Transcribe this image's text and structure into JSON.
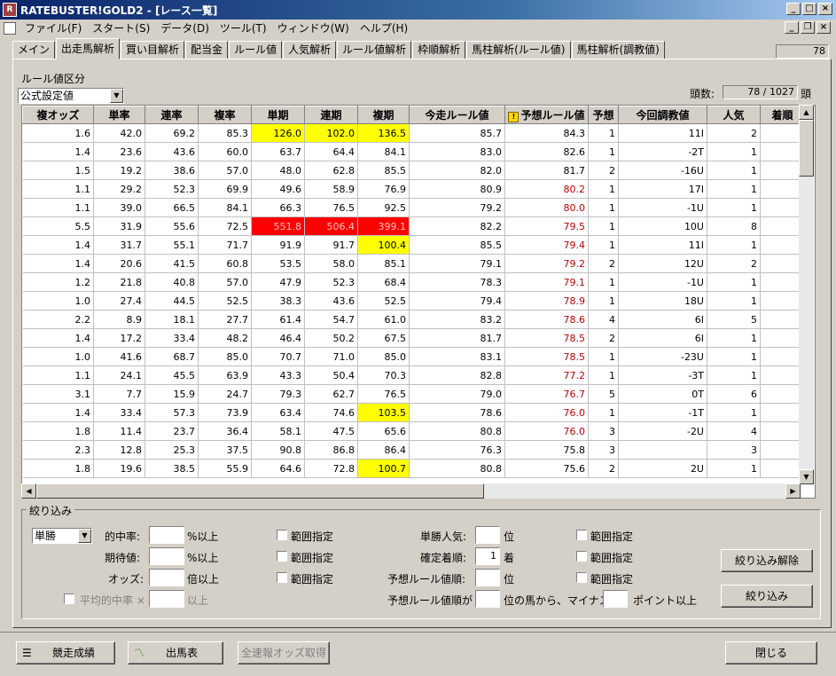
{
  "window": {
    "title": "RATEBUSTER!GOLD2 - [レース一覧]",
    "app_icon": "app-icon"
  },
  "menu": [
    "ファイル(F)",
    "スタート(S)",
    "データ(D)",
    "ツール(T)",
    "ウィンドウ(W)",
    "ヘルプ(H)"
  ],
  "tabs": [
    "メイン",
    "出走馬解析",
    "買い目解析",
    "配当金",
    "ルール値",
    "人気解析",
    "ルール値解析",
    "枠順解析",
    "馬柱解析(ルール値)",
    "馬柱解析(調教値)"
  ],
  "active_tab": "出走馬解析",
  "top_count": "78",
  "rule_section": {
    "label": "ルール値区分",
    "selected": "公式設定値"
  },
  "head_count": {
    "label": "頭数:",
    "value": "78 / 1027",
    "unit": "頭"
  },
  "grid": {
    "columns": [
      "複オッズ",
      "単率",
      "連率",
      "複率",
      "単期",
      "連期",
      "複期",
      "今走ルール値",
      "予想ルール値",
      "予想",
      "今回調教値",
      "人気",
      "着順"
    ],
    "rows": [
      [
        "1.6",
        "42.0",
        "69.2",
        "85.3",
        "126.0",
        "102.0",
        "136.5",
        "85.7",
        "84.3",
        "1",
        "11I",
        "2",
        ""
      ],
      [
        "1.4",
        "23.6",
        "43.6",
        "60.0",
        "63.7",
        "64.4",
        "84.1",
        "83.0",
        "82.6",
        "1",
        "-2T",
        "1",
        ""
      ],
      [
        "1.5",
        "19.2",
        "38.6",
        "57.0",
        "48.0",
        "62.8",
        "85.5",
        "82.0",
        "81.7",
        "2",
        "-16U",
        "1",
        ""
      ],
      [
        "1.1",
        "29.2",
        "52.3",
        "69.9",
        "49.6",
        "58.9",
        "76.9",
        "80.9",
        "80.2",
        "1",
        "17I",
        "1",
        ""
      ],
      [
        "1.1",
        "39.0",
        "66.5",
        "84.1",
        "66.3",
        "76.5",
        "92.5",
        "79.2",
        "80.0",
        "1",
        "-1U",
        "1",
        ""
      ],
      [
        "5.5",
        "31.9",
        "55.6",
        "72.5",
        "551.8",
        "506.4",
        "399.1",
        "82.2",
        "79.5",
        "1",
        "10U",
        "8",
        ""
      ],
      [
        "1.4",
        "31.7",
        "55.1",
        "71.7",
        "91.9",
        "91.7",
        "100.4",
        "85.5",
        "79.4",
        "1",
        "11I",
        "1",
        ""
      ],
      [
        "1.4",
        "20.6",
        "41.5",
        "60.8",
        "53.5",
        "58.0",
        "85.1",
        "79.1",
        "79.2",
        "2",
        "12U",
        "2",
        ""
      ],
      [
        "1.2",
        "21.8",
        "40.8",
        "57.0",
        "47.9",
        "52.3",
        "68.4",
        "78.3",
        "79.1",
        "1",
        "-1U",
        "1",
        ""
      ],
      [
        "1.0",
        "27.4",
        "44.5",
        "52.5",
        "38.3",
        "43.6",
        "52.5",
        "79.4",
        "78.9",
        "1",
        "18U",
        "1",
        ""
      ],
      [
        "2.2",
        "8.9",
        "18.1",
        "27.7",
        "61.4",
        "54.7",
        "61.0",
        "83.2",
        "78.6",
        "4",
        "6I",
        "5",
        ""
      ],
      [
        "1.4",
        "17.2",
        "33.4",
        "48.2",
        "46.4",
        "50.2",
        "67.5",
        "81.7",
        "78.5",
        "2",
        "6I",
        "1",
        ""
      ],
      [
        "1.0",
        "41.6",
        "68.7",
        "85.0",
        "70.7",
        "71.0",
        "85.0",
        "83.1",
        "78.5",
        "1",
        "-23U",
        "1",
        ""
      ],
      [
        "1.1",
        "24.1",
        "45.5",
        "63.9",
        "43.3",
        "50.4",
        "70.3",
        "82.8",
        "77.2",
        "1",
        "-3T",
        "1",
        ""
      ],
      [
        "3.1",
        "7.7",
        "15.9",
        "24.7",
        "79.3",
        "62.7",
        "76.5",
        "79.0",
        "76.7",
        "5",
        "0T",
        "6",
        ""
      ],
      [
        "1.4",
        "33.4",
        "57.3",
        "73.9",
        "63.4",
        "74.6",
        "103.5",
        "78.6",
        "76.0",
        "1",
        "-1T",
        "1",
        ""
      ],
      [
        "1.8",
        "11.4",
        "23.7",
        "36.4",
        "58.1",
        "47.5",
        "65.6",
        "80.8",
        "76.0",
        "3",
        "-2U",
        "4",
        ""
      ],
      [
        "2.3",
        "12.8",
        "25.3",
        "37.5",
        "90.8",
        "86.8",
        "86.4",
        "76.3",
        "75.8",
        "3",
        "",
        "3",
        ""
      ],
      [
        "1.8",
        "19.6",
        "38.5",
        "55.9",
        "64.6",
        "72.8",
        "100.7",
        "80.8",
        "75.6",
        "2",
        "2U",
        "1",
        ""
      ]
    ]
  },
  "filter": {
    "legend": "絞り込み",
    "bet_type": "単勝",
    "hit_rate": "的中率:",
    "expectation": "期待値:",
    "odds": "オッズ:",
    "percent_over": "%以上",
    "times_over": "倍以上",
    "range": "範囲指定",
    "avg_hit": "平均的中率 ×",
    "over": "以上",
    "win_pop": "単勝人気:",
    "fixed_rank": "確定着順:",
    "fixed_rank_value": "1",
    "pred_rank": "予想ルール値順:",
    "pos": "位",
    "rank_unit": "着",
    "pred_rank_from": "予想ルール値順が",
    "pos_from": "位の馬から、マイナス",
    "point_over": "ポイント以上",
    "clear_btn": "絞り込み解除",
    "apply_btn": "絞り込み"
  },
  "bottom": {
    "results_btn": "競走成績",
    "entries_btn": "出馬表",
    "odds_btn": "全速報オッズ取得",
    "close_btn": "閉じる"
  }
}
